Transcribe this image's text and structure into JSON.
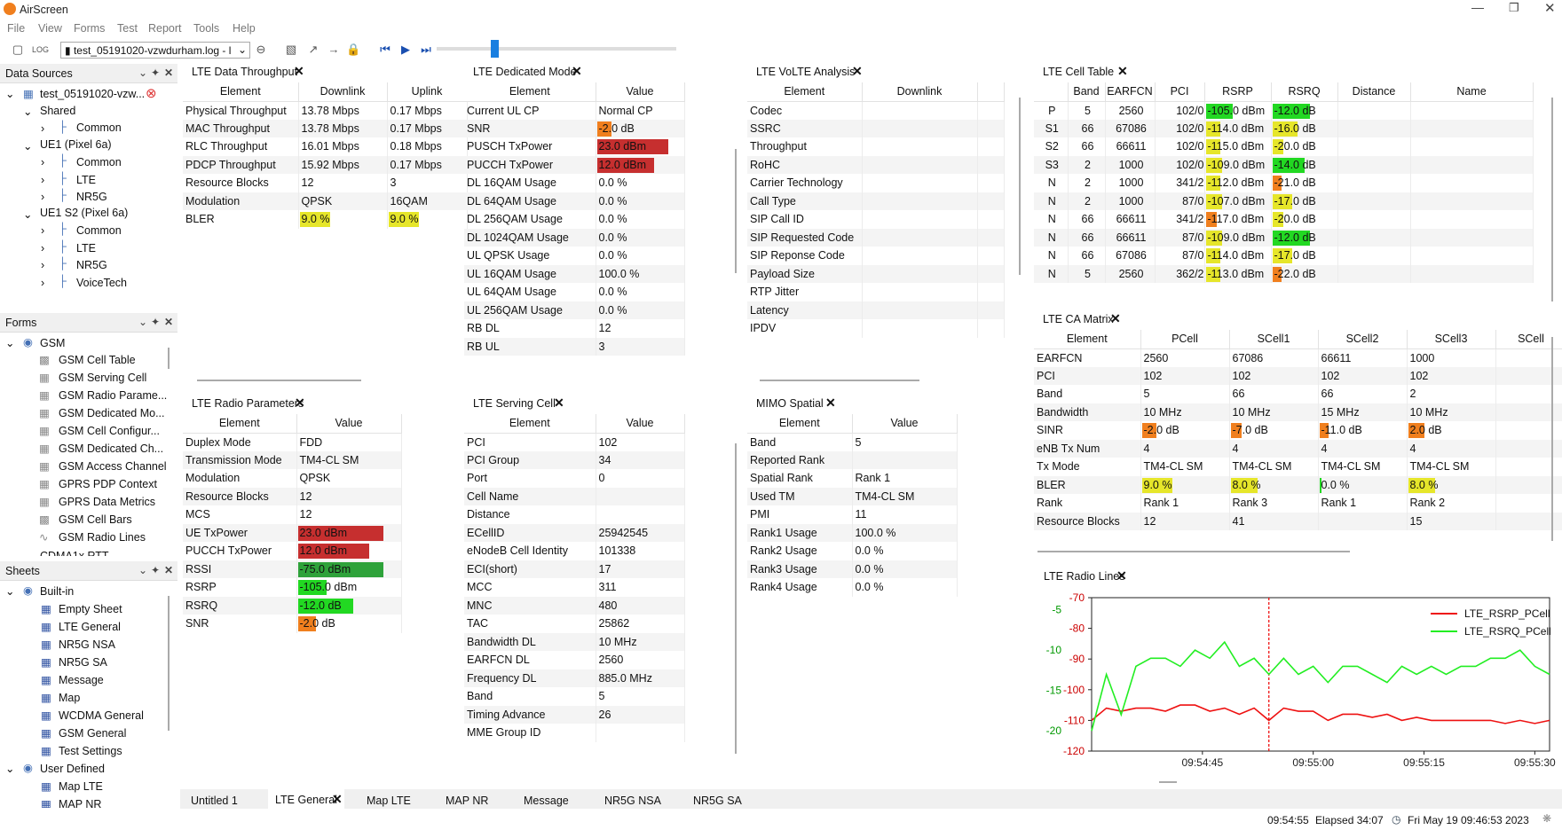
{
  "app": {
    "title": "AirScreen"
  },
  "menu": [
    "File",
    "View",
    "Forms",
    "Test",
    "Report",
    "Tools",
    "Help"
  ],
  "toolbar": {
    "file": "test_05191020-vzwdurham.log - l"
  },
  "data_sources": {
    "title": "Data Sources",
    "file": "test_05191020-vzw...",
    "shared": "Shared",
    "common": "Common",
    "ue1": "UE1 (Pixel 6a)",
    "lte": "LTE",
    "nr5g": "NR5G",
    "ue1s2": "UE1 S2 (Pixel 6a)",
    "voicetech": "VoiceTech"
  },
  "forms": {
    "title": "Forms",
    "gsm": "GSM",
    "items": [
      "GSM Cell Table",
      "GSM Serving Cell",
      "GSM Radio Parame...",
      "GSM Dedicated Mo...",
      "GSM Cell Configur...",
      "GSM Dedicated Ch...",
      "GSM Access Channel",
      "GPRS PDP Context",
      "GPRS Data Metrics",
      "GSM Cell Bars",
      "GSM Radio Lines"
    ],
    "cut": "CDMA1x RTT"
  },
  "sheets": {
    "title": "Sheets",
    "builtin": "Built-in",
    "items": [
      "Empty Sheet",
      "LTE General",
      "NR5G NSA",
      "NR5G SA",
      "Message",
      "Map",
      "WCDMA General",
      "GSM General",
      "Test Settings"
    ],
    "user": "User Defined",
    "user_items": [
      "Map LTE",
      "MAP NR"
    ]
  },
  "throughput": {
    "title": "LTE Data Throughput",
    "headers": [
      "Element",
      "Downlink",
      "Uplink"
    ],
    "rows": [
      [
        "Physical Throughput",
        "13.78 Mbps",
        "0.17 Mbps"
      ],
      [
        "MAC Throughput",
        "13.78 Mbps",
        "0.17 Mbps"
      ],
      [
        "RLC Throughput",
        "16.01 Mbps",
        "0.18 Mbps"
      ],
      [
        "PDCP Throughput",
        "15.92 Mbps",
        "0.17 Mbps"
      ],
      [
        "Resource Blocks",
        "12",
        "3"
      ],
      [
        "Modulation",
        "QPSK",
        "16QAM"
      ],
      [
        "BLER",
        "9.0 %",
        "9.0 %"
      ]
    ]
  },
  "dedicated": {
    "title": "LTE Dedicated Mode",
    "headers": [
      "Element",
      "Value"
    ],
    "rows": [
      [
        "Current UL CP",
        "Normal CP"
      ],
      [
        "SNR",
        "-2.0 dB"
      ],
      [
        "PUSCH TxPower",
        "23.0 dBm"
      ],
      [
        "PUCCH TxPower",
        "12.0 dBm"
      ],
      [
        "DL 16QAM Usage",
        "0.0 %"
      ],
      [
        "DL 64QAM Usage",
        "0.0 %"
      ],
      [
        "DL 256QAM Usage",
        "0.0 %"
      ],
      [
        "DL 1024QAM Usage",
        "0.0 %"
      ],
      [
        "UL QPSK Usage",
        "0.0 %"
      ],
      [
        "UL 16QAM Usage",
        "100.0 %"
      ],
      [
        "UL 64QAM Usage",
        "0.0 %"
      ],
      [
        "UL 256QAM Usage",
        "0.0 %"
      ],
      [
        "RB DL",
        "12"
      ],
      [
        "RB UL",
        "3"
      ]
    ]
  },
  "volte": {
    "title": "LTE VoLTE Analysis",
    "headers": [
      "Element",
      "Downlink"
    ],
    "rows": [
      "Codec",
      "SSRC",
      "Throughput",
      "RoHC",
      "Carrier Technology",
      "Call Type",
      "SIP Call ID",
      "SIP Requested Code",
      "SIP Reponse Code",
      "Payload Size",
      "RTP Jitter",
      "Latency",
      "IPDV"
    ]
  },
  "celltable": {
    "title": "LTE Cell Table",
    "headers": [
      "",
      "Band",
      "EARFCN",
      "PCI",
      "RSRP",
      "RSRQ",
      "Distance",
      "Name"
    ],
    "rows": [
      [
        "P",
        "5",
        "2560",
        "102/0",
        "-105.0 dBm",
        "-12.0 dB"
      ],
      [
        "S1",
        "66",
        "67086",
        "102/0",
        "-114.0 dBm",
        "-16.0 dB"
      ],
      [
        "S2",
        "66",
        "66611",
        "102/0",
        "-115.0 dBm",
        "-20.0 dB"
      ],
      [
        "S3",
        "2",
        "1000",
        "102/0",
        "-109.0 dBm",
        "-14.0 dB"
      ],
      [
        "N",
        "2",
        "1000",
        "341/2",
        "-112.0 dBm",
        "-21.0 dB"
      ],
      [
        "N",
        "2",
        "1000",
        "87/0",
        "-107.0 dBm",
        "-17.0 dB"
      ],
      [
        "N",
        "66",
        "66611",
        "341/2",
        "-117.0 dBm",
        "-20.0 dB"
      ],
      [
        "N",
        "66",
        "66611",
        "87/0",
        "-109.0 dBm",
        "-12.0 dB"
      ],
      [
        "N",
        "66",
        "67086",
        "87/0",
        "-114.0 dBm",
        "-17.0 dB"
      ],
      [
        "N",
        "5",
        "2560",
        "362/2",
        "-113.0 dBm",
        "-22.0 dB"
      ]
    ]
  },
  "camatrix": {
    "title": "LTE CA Matrix",
    "headers": [
      "Element",
      "PCell",
      "SCell1",
      "SCell2",
      "SCell3",
      "SCell"
    ],
    "rows": [
      [
        "EARFCN",
        "2560",
        "67086",
        "66611",
        "1000"
      ],
      [
        "PCI",
        "102",
        "102",
        "102",
        "102"
      ],
      [
        "Band",
        "5",
        "66",
        "66",
        "2"
      ],
      [
        "Bandwidth",
        "10 MHz",
        "10 MHz",
        "15 MHz",
        "10 MHz"
      ],
      [
        "SINR",
        "-2.0 dB",
        "-7.0 dB",
        "-11.0 dB",
        "2.0 dB"
      ],
      [
        "eNB Tx Num",
        "4",
        "4",
        "4",
        "4"
      ],
      [
        "Tx Mode",
        "TM4-CL SM",
        "TM4-CL SM",
        "TM4-CL SM",
        "TM4-CL SM"
      ],
      [
        "BLER",
        "9.0 %",
        "8.0 %",
        "0.0 %",
        "8.0 %"
      ],
      [
        "Rank",
        "Rank 1",
        "Rank 3",
        "Rank 1",
        "Rank 2"
      ],
      [
        "Resource Blocks",
        "12",
        "41",
        "",
        "15"
      ]
    ]
  },
  "radio": {
    "title": "LTE Radio Parameters",
    "headers": [
      "Element",
      "Value"
    ],
    "rows": [
      [
        "Duplex Mode",
        "FDD"
      ],
      [
        "Transmission Mode",
        "TM4-CL SM"
      ],
      [
        "Modulation",
        "QPSK"
      ],
      [
        "Resource Blocks",
        "12"
      ],
      [
        "MCS",
        "12"
      ],
      [
        "UE TxPower",
        "23.0 dBm"
      ],
      [
        "PUCCH TxPower",
        "12.0 dBm"
      ],
      [
        "RSSI",
        "-75.0 dBm"
      ],
      [
        "RSRP",
        "-105.0 dBm"
      ],
      [
        "RSRQ",
        "-12.0 dB"
      ],
      [
        "SNR",
        "-2.0 dB"
      ]
    ]
  },
  "serving": {
    "title": "LTE Serving Cell",
    "headers": [
      "Element",
      "Value"
    ],
    "rows": [
      [
        "PCI",
        "102"
      ],
      [
        "PCI Group",
        "34"
      ],
      [
        "Port",
        "0"
      ],
      [
        "Cell Name",
        ""
      ],
      [
        "Distance",
        ""
      ],
      [
        "ECellID",
        "25942545"
      ],
      [
        "eNodeB Cell Identity",
        "101338"
      ],
      [
        "ECI(short)",
        "17"
      ],
      [
        "MCC",
        "311"
      ],
      [
        "MNC",
        "480"
      ],
      [
        "TAC",
        "25862"
      ],
      [
        "Bandwidth DL",
        "10 MHz"
      ],
      [
        "EARFCN DL",
        "2560"
      ],
      [
        "Frequency DL",
        "885.0 MHz"
      ],
      [
        "Band",
        "5"
      ],
      [
        "Timing Advance",
        "26"
      ],
      [
        "MME Group ID",
        ""
      ]
    ]
  },
  "mimo": {
    "title": "MIMO Spatial",
    "headers": [
      "Element",
      "Value"
    ],
    "rows": [
      [
        "Band",
        "5"
      ],
      [
        "Reported Rank",
        ""
      ],
      [
        "Spatial Rank",
        "Rank 1"
      ],
      [
        "Used TM",
        "TM4-CL SM"
      ],
      [
        "PMI",
        "11"
      ],
      [
        "Rank1 Usage",
        "100.0 %"
      ],
      [
        "Rank2 Usage",
        "0.0 %"
      ],
      [
        "Rank3 Usage",
        "0.0 %"
      ],
      [
        "Rank4 Usage",
        "0.0 %"
      ]
    ]
  },
  "radiolines": {
    "title": "LTE Radio Lines"
  },
  "chart_data": {
    "type": "line",
    "x": [
      "09:54:30",
      "09:54:32",
      "09:54:34",
      "09:54:36",
      "09:54:38",
      "09:54:40",
      "09:54:42",
      "09:54:44",
      "09:54:46",
      "09:54:48",
      "09:54:50",
      "09:54:52",
      "09:54:54",
      "09:54:56",
      "09:54:58",
      "09:55:00",
      "09:55:02",
      "09:55:04",
      "09:55:06",
      "09:55:08",
      "09:55:10",
      "09:55:12",
      "09:55:14",
      "09:55:16",
      "09:55:18",
      "09:55:20",
      "09:55:22",
      "09:55:24",
      "09:55:26",
      "09:55:28",
      "09:55:30",
      "09:55:32"
    ],
    "xticks": [
      "09:54:45",
      "09:55:00",
      "09:55:15",
      "09:55:30"
    ],
    "series": [
      {
        "name": "LTE_RSRP_PCell",
        "color": "#ee1111",
        "axis": "left",
        "values": [
          -110,
          -106,
          -107,
          -106,
          -106,
          -107,
          -105,
          -105,
          -107,
          -106,
          -108,
          -106,
          -110,
          -106,
          -107,
          -107,
          -110,
          -108,
          -108,
          -109,
          -108,
          -110,
          -109,
          -110,
          -110,
          -110,
          -110,
          -110,
          -111,
          -110,
          -111,
          -110
        ]
      },
      {
        "name": "LTE_RSRQ_PCell",
        "color": "#22ee22",
        "axis": "right",
        "values": [
          -20,
          -13,
          -18,
          -12,
          -11,
          -11,
          -12,
          -10,
          -11,
          -9,
          -12,
          -11,
          -13,
          -11,
          -13,
          -12,
          -14,
          -12,
          -12,
          -13,
          -14,
          -12,
          -13,
          -12,
          -13,
          -12,
          -12,
          -11,
          -11,
          -10,
          -12,
          -13
        ]
      }
    ],
    "yleft": {
      "ticks": [
        -70,
        -80,
        -90,
        -100,
        -110,
        -120
      ],
      "range": [
        -120,
        -70
      ],
      "color": "#cc0000"
    },
    "yright": {
      "ticks": [
        -5,
        -10,
        -15,
        -20
      ],
      "range": [
        -22.5,
        -3.5
      ],
      "color": "#009900"
    },
    "marker": "09:54:54"
  },
  "bottom_tabs": [
    "Untitled 1",
    "LTE General",
    "Map LTE",
    "MAP NR",
    "Message",
    "NR5G NSA",
    "NR5G SA"
  ],
  "status": {
    "time": "09:54:55",
    "elapsed": "Elapsed 34:07",
    "date": "Fri May 19 09:46:53 2023"
  },
  "colors": {
    "red": "#c62f2f",
    "orange": "#f07f1e",
    "yellow": "#e6e62a",
    "green": "#22d822",
    "darkgreen": "#2ea23a"
  }
}
